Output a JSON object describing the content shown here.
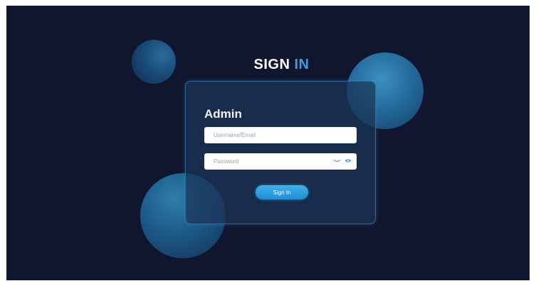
{
  "page": {
    "title_main": "SIGN",
    "title_accent": "IN"
  },
  "login": {
    "heading": "Admin",
    "username_placeholder": "Username/Email",
    "username_value": "",
    "password_placeholder": "Password",
    "password_value": "",
    "submit_label": "Sign In",
    "icons": [
      "hidden-eye-icon",
      "eye-icon"
    ]
  },
  "colors": {
    "background": "#11162f",
    "accent": "#3a9ee0",
    "button": "#2ba0e2",
    "card_border": "#2b6e9b"
  }
}
